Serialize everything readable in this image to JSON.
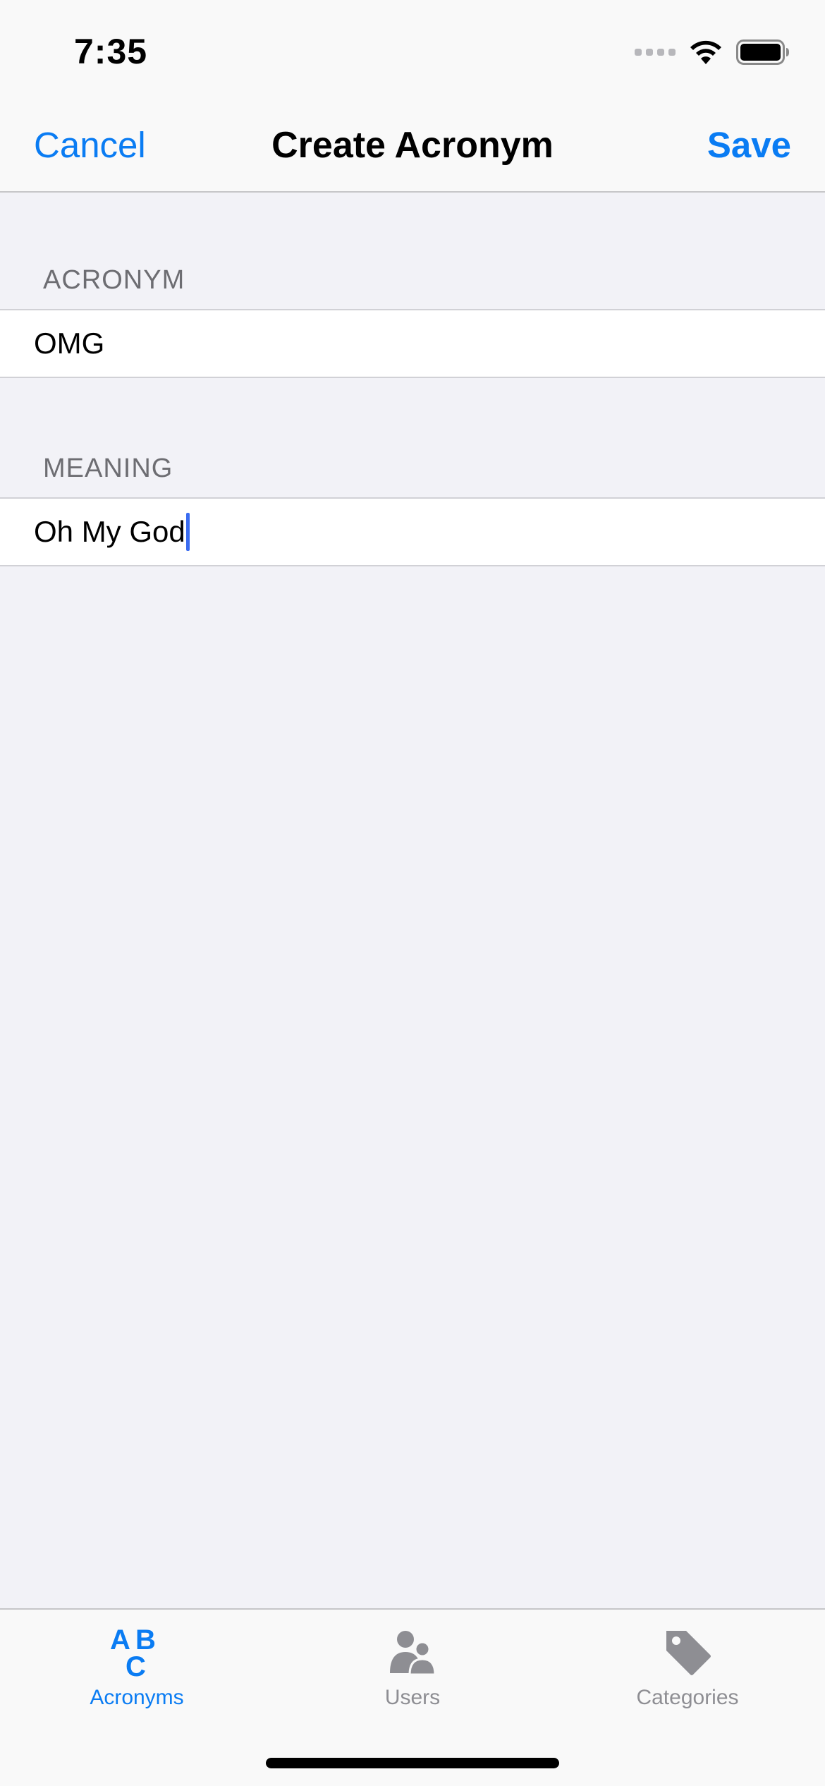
{
  "status_bar": {
    "time": "7:35"
  },
  "nav": {
    "cancel_label": "Cancel",
    "title": "Create Acronym",
    "save_label": "Save"
  },
  "form": {
    "acronym_header": "ACRONYM",
    "acronym_value": "OMG",
    "meaning_header": "MEANING",
    "meaning_value": "Oh My God"
  },
  "tabs": [
    {
      "label": "Acronyms",
      "icon": "abc-icon",
      "selected": true
    },
    {
      "label": "Users",
      "icon": "users-icon",
      "selected": false
    },
    {
      "label": "Categories",
      "icon": "tag-icon",
      "selected": false
    }
  ],
  "colors": {
    "accent": "#0a7cf3",
    "inactive_tab": "#8e8e93",
    "background": "#f2f2f7",
    "caret": "#3a6cf0"
  }
}
